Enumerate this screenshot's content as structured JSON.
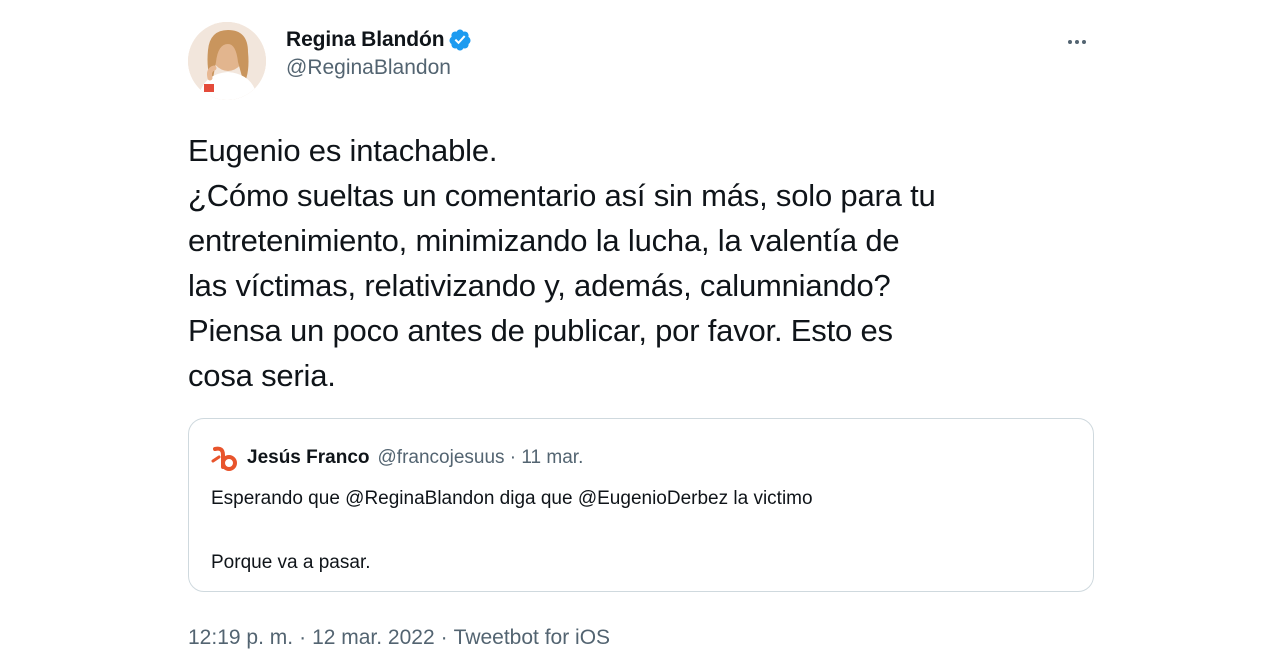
{
  "author": {
    "display_name": "Regina Blandón",
    "handle": "@ReginaBlandon",
    "verified": true
  },
  "tweet": {
    "text": "Eugenio es intachable.\n¿Cómo sueltas un comentario así sin más, solo para tu\nentretenimiento, minimizando la lucha, la valentía de\nlas víctimas, relativizando y, además, calumniando?\nPiensa un poco antes de publicar, por favor. Esto es\ncosa seria."
  },
  "quoted": {
    "display_name": "Jesús Franco",
    "meta": "@francojesuus · 11 mar.",
    "text": "Esperando que @ReginaBlandon diga que @EugenioDerbez la victimo\n\nPorque va a pasar."
  },
  "footer": {
    "time": "12:19 p. m.",
    "sep1": "·",
    "date": "12 mar. 2022",
    "sep2": "·",
    "source": "Tweetbot for iOS"
  },
  "colors": {
    "verified": "#1d9bf0",
    "secondary_text": "#536471",
    "border": "#cfd9de",
    "quote_avatar": "#e8542c"
  },
  "icons": {
    "more": "more-horizontal-icon",
    "verified": "verified-badge-icon"
  }
}
